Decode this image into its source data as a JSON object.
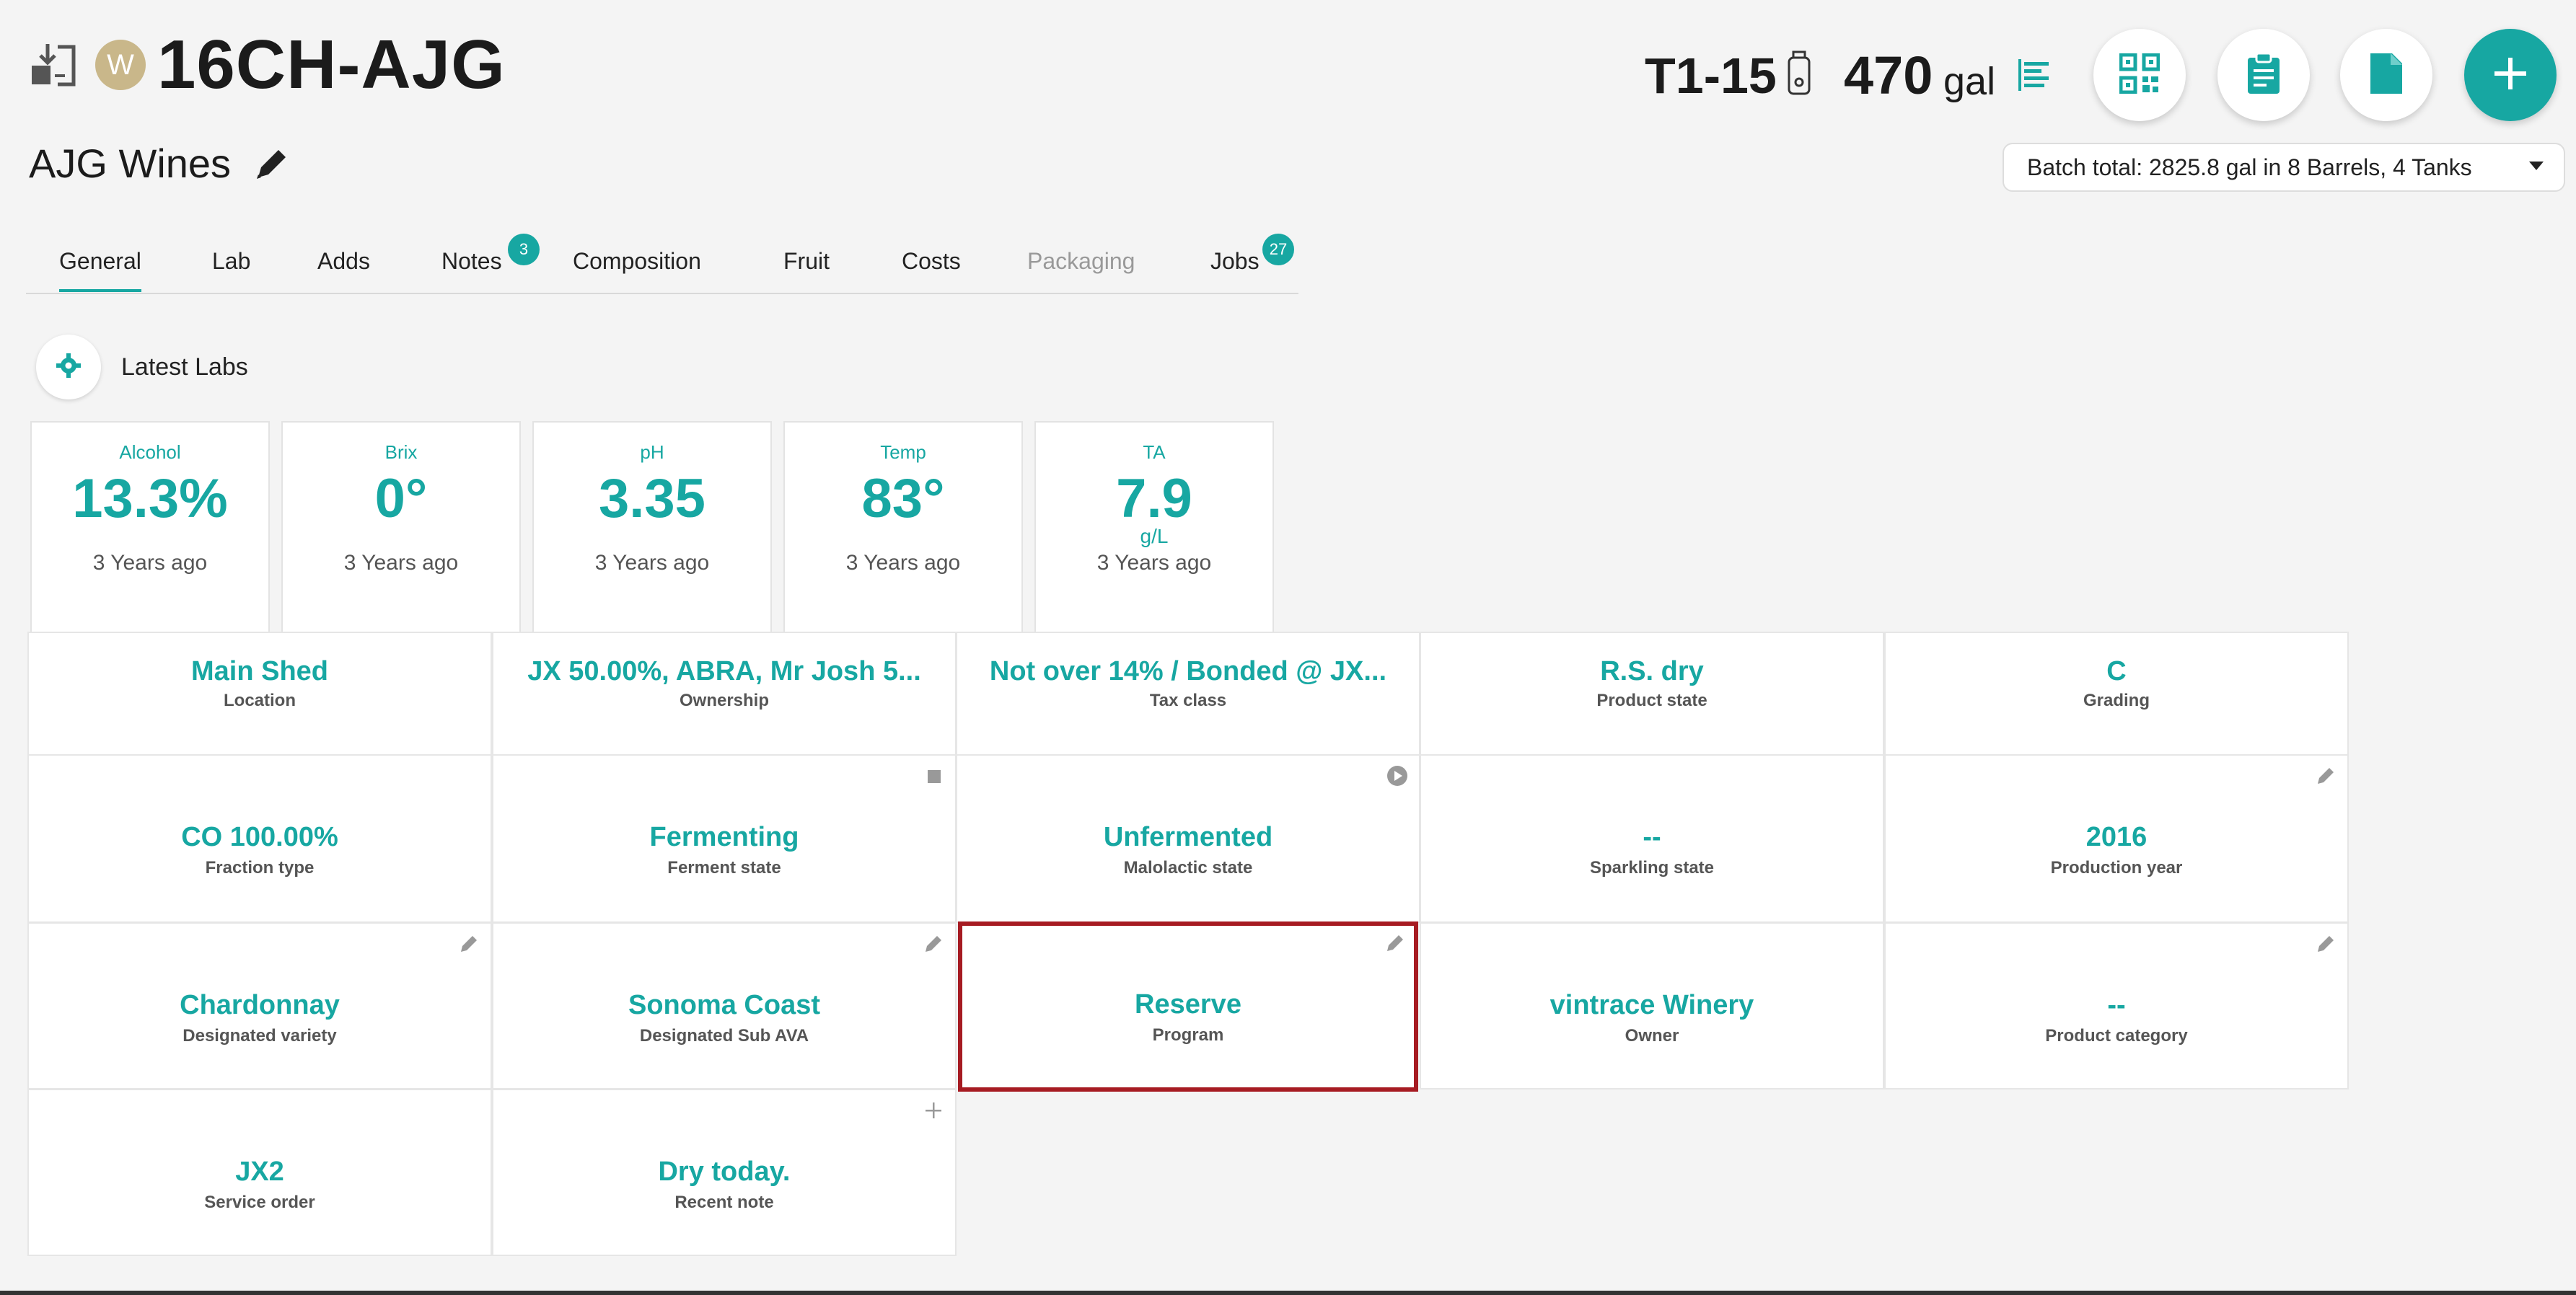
{
  "header": {
    "avatar_letter": "W",
    "batch_code": "16CH-AJG",
    "winery_name": "AJG Wines",
    "vessel_code": "T1-15",
    "volume_value": "470",
    "volume_unit": "gal",
    "batch_total": "Batch total: 2825.8 gal in 8 Barrels, 4 Tanks"
  },
  "tabs": [
    {
      "label": "General",
      "active": true
    },
    {
      "label": "Lab"
    },
    {
      "label": "Adds"
    },
    {
      "label": "Notes",
      "badge": "3"
    },
    {
      "label": "Composition"
    },
    {
      "label": "Fruit"
    },
    {
      "label": "Costs"
    },
    {
      "label": "Packaging",
      "disabled": true
    },
    {
      "label": "Jobs",
      "badge": "27"
    }
  ],
  "latest_labs": {
    "title": "Latest Labs",
    "cards": [
      {
        "name": "Alcohol",
        "value": "13.3%",
        "unit": "",
        "when": "3 Years ago"
      },
      {
        "name": "Brix",
        "value": "0°",
        "unit": "",
        "when": "3 Years ago"
      },
      {
        "name": "pH",
        "value": "3.35",
        "unit": "",
        "when": "3 Years ago"
      },
      {
        "name": "Temp",
        "value": "83°",
        "unit": "",
        "when": "3 Years ago"
      },
      {
        "name": "TA",
        "value": "7.9",
        "unit": "g/L",
        "when": "3 Years ago"
      }
    ]
  },
  "attributes": {
    "location": {
      "value": "Main Shed",
      "label": "Location"
    },
    "ownership": {
      "value": "JX 50.00%, ABRA, Mr Josh 5...",
      "label": "Ownership"
    },
    "tax_class": {
      "value": "Not over 14% / Bonded @ JX...",
      "label": "Tax class"
    },
    "product_state": {
      "value": "R.S. dry",
      "label": "Product state"
    },
    "grading": {
      "value": "C",
      "label": "Grading"
    },
    "fraction_type": {
      "value": "CO 100.00%",
      "label": "Fraction type"
    },
    "ferment_state": {
      "value": "Fermenting",
      "label": "Ferment state"
    },
    "malolactic_state": {
      "value": "Unfermented",
      "label": "Malolactic state"
    },
    "sparkling_state": {
      "value": "--",
      "label": "Sparkling state"
    },
    "production_year": {
      "value": "2016",
      "label": "Production year"
    },
    "designated_variety": {
      "value": "Chardonnay",
      "label": "Designated variety"
    },
    "designated_sub_ava": {
      "value": "Sonoma Coast",
      "label": "Designated Sub AVA"
    },
    "program": {
      "value": "Reserve",
      "label": "Program"
    },
    "owner": {
      "value": "vintrace Winery",
      "label": "Owner"
    },
    "product_category": {
      "value": "--",
      "label": "Product category"
    },
    "service_order": {
      "value": "JX2",
      "label": "Service order"
    },
    "recent_note": {
      "value": "Dry today.",
      "label": "Recent note"
    }
  },
  "colors": {
    "accent": "#17a7a2",
    "selected_border": "#a61b22",
    "avatar": "#c9b78a"
  },
  "icons": {
    "header": [
      "import-icon",
      "tank-icon",
      "list-lines-icon",
      "qr-code-icon",
      "clipboard-icon",
      "document-icon",
      "plus-icon",
      "pencil-icon"
    ],
    "labs": "gear-icon"
  }
}
